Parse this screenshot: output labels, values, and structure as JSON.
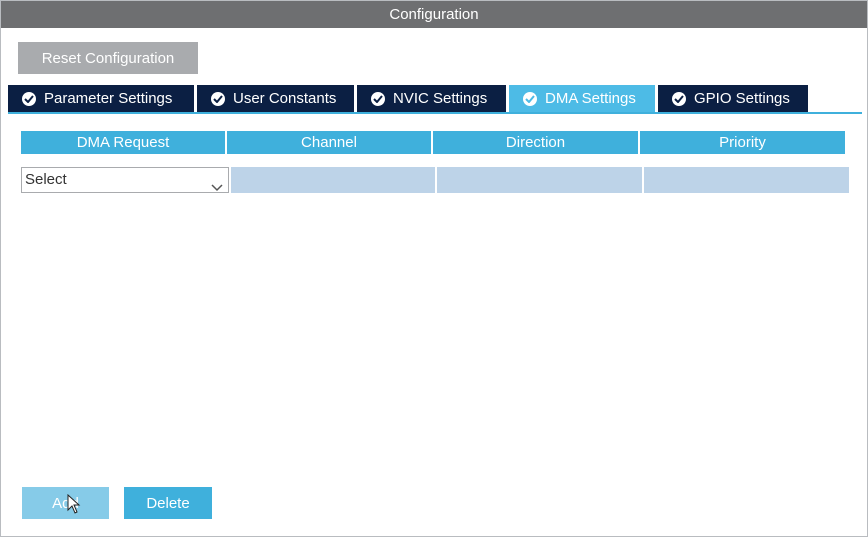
{
  "window": {
    "title": "Configuration"
  },
  "toolbar": {
    "reset_label": "Reset Configuration"
  },
  "tabs": [
    {
      "label": "Parameter Settings",
      "active": false
    },
    {
      "label": "User Constants",
      "active": false
    },
    {
      "label": "NVIC Settings",
      "active": false
    },
    {
      "label": "DMA Settings",
      "active": true
    },
    {
      "label": "GPIO Settings",
      "active": false
    }
  ],
  "table": {
    "columns": [
      "DMA Request",
      "Channel",
      "Direction",
      "Priority"
    ],
    "row": {
      "request_select_value": "Select",
      "channel": "",
      "direction": "",
      "priority": ""
    }
  },
  "actions": {
    "add_label": "Add",
    "delete_label": "Delete"
  },
  "colors": {
    "titlebar": "#6e6f71",
    "tab_inactive": "#0b1f43",
    "tab_active": "#4dbbe6",
    "header": "#3fb0dc",
    "row_fill": "#bdd3e8"
  }
}
